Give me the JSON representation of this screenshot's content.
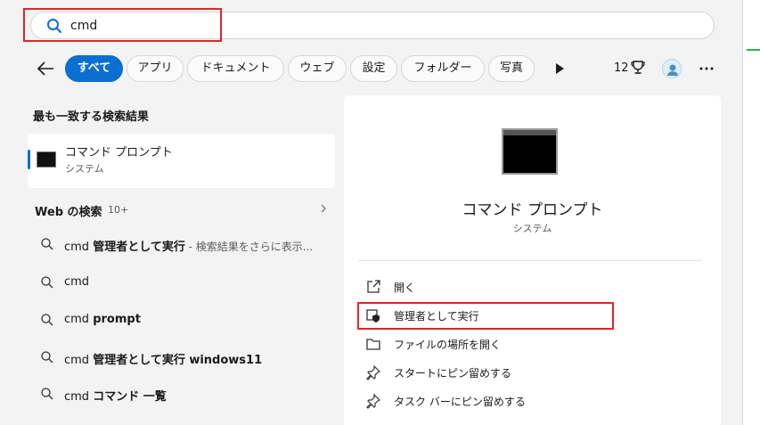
{
  "search": {
    "query": "cmd"
  },
  "filters": {
    "chips": [
      "すべて",
      "アプリ",
      "ドキュメント",
      "ウェブ",
      "設定",
      "フォルダー",
      "写真"
    ],
    "count": "12"
  },
  "best_match": {
    "heading": "最も一致する検索結果",
    "title": "コマンド プロンプト",
    "subtitle": "システム"
  },
  "web": {
    "heading": "Web の検索",
    "count": "10+",
    "items": [
      {
        "plain": "cmd ",
        "bold": "管理者として実行",
        "muted": " - 検索結果をさらに表示..."
      },
      {
        "plain": "cmd",
        "bold": "",
        "muted": ""
      },
      {
        "plain": "cmd ",
        "bold": "prompt",
        "muted": ""
      },
      {
        "plain": "cmd ",
        "bold": "管理者として実行 windows11",
        "muted": ""
      },
      {
        "plain": "cmd ",
        "bold": "コマンド 一覧",
        "muted": ""
      }
    ]
  },
  "detail": {
    "title": "コマンド プロンプト",
    "subtitle": "システム",
    "actions": [
      {
        "label": "開く",
        "icon": "open-external-icon"
      },
      {
        "label": "管理者として実行",
        "icon": "shield-admin-icon"
      },
      {
        "label": "ファイルの場所を開く",
        "icon": "folder-icon"
      },
      {
        "label": "スタートにピン留めする",
        "icon": "pin-icon"
      },
      {
        "label": "タスク バーにピン留めする",
        "icon": "pin-icon"
      }
    ]
  },
  "colors": {
    "accent": "#0b6fcf",
    "highlight": "#e0252a"
  }
}
